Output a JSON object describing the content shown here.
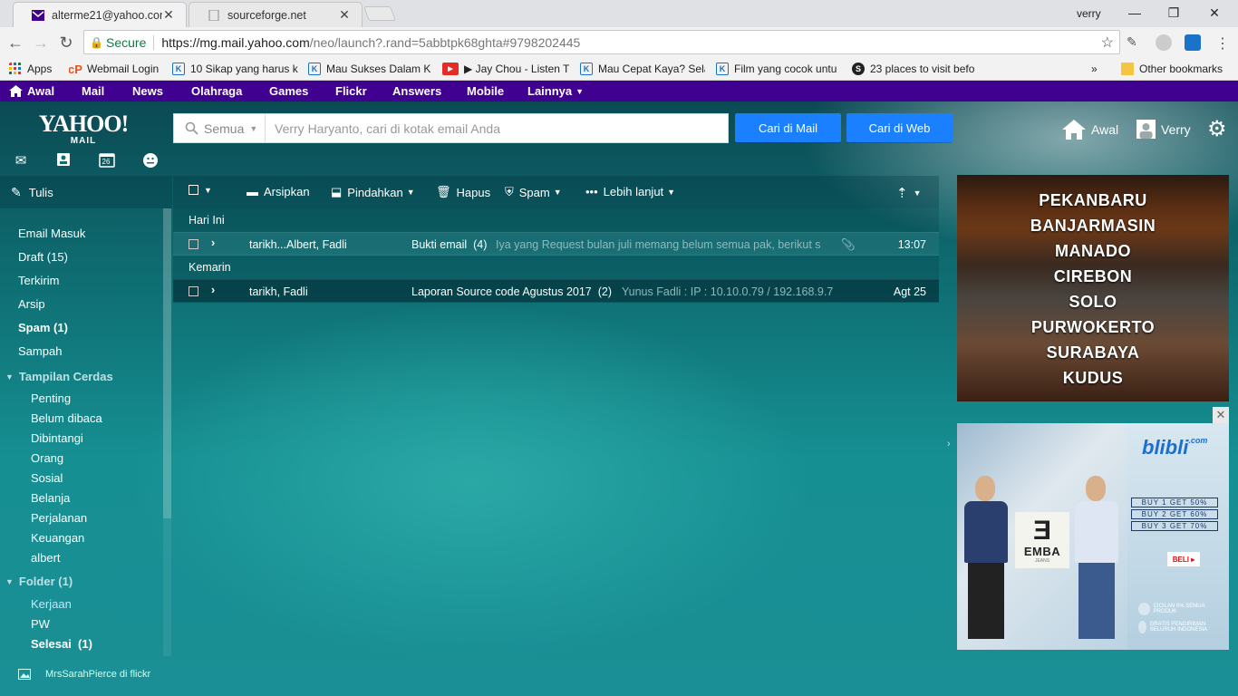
{
  "browser": {
    "tabs": [
      {
        "title": "alterme21@yahoo.com -",
        "favicon": "yahoo-mail-icon",
        "active": true
      },
      {
        "title": "sourceforge.net",
        "favicon": "page-icon",
        "active": false
      }
    ],
    "profile_name": "verry",
    "security_label": "Secure",
    "url_host": "https://mg.mail.yahoo.com",
    "url_path": "/neo/launch?.rand=5abbtpk68ghta#9798202445",
    "bookmarks": [
      {
        "label": "Apps",
        "icon": "apps-grid-icon"
      },
      {
        "label": "Webmail Login",
        "icon": "webmail-icon"
      },
      {
        "label": "10 Sikap yang harus k",
        "icon": "k-icon"
      },
      {
        "label": "Mau Sukses Dalam K",
        "icon": "k-icon"
      },
      {
        "label": "▶ Jay Chou - Listen T",
        "icon": "youtube-icon"
      },
      {
        "label": "Mau Cepat Kaya? Sela",
        "icon": "k-icon"
      },
      {
        "label": "Film yang cocok untu",
        "icon": "k-icon"
      },
      {
        "label": "23 places to visit befo",
        "icon": "scribd-icon"
      },
      {
        "label": "»",
        "icon": "more-icon"
      },
      {
        "label": "Other bookmarks",
        "icon": "folder-icon"
      }
    ]
  },
  "yahoo_nav": [
    "Awal",
    "Mail",
    "News",
    "Olahraga",
    "Games",
    "Flickr",
    "Answers",
    "Mobile",
    "Lainnya"
  ],
  "header": {
    "logo_top": "YAHOO!",
    "logo_bottom": "MAIL",
    "calendar_day": "26",
    "search_scope": "Semua",
    "search_placeholder": "Verry Haryanto, cari di kotak email Anda",
    "btn_mail": "Cari di Mail",
    "btn_web": "Cari di Web",
    "home_label": "Awal",
    "user_label": "Verry"
  },
  "sidebar": {
    "compose": "Tulis",
    "folders": [
      {
        "label": "Email Masuk",
        "bold": false
      },
      {
        "label": "Draft (15)",
        "bold": false
      },
      {
        "label": "Terkirim",
        "bold": false
      },
      {
        "label": "Arsip",
        "bold": false
      },
      {
        "label": "Spam (1)",
        "bold": true
      },
      {
        "label": "Sampah",
        "bold": false
      }
    ],
    "smart_title": "Tampilan Cerdas",
    "smart_views": [
      "Penting",
      "Belum dibaca",
      "Dibintangi",
      "Orang",
      "Sosial",
      "Belanja",
      "Perjalanan",
      "Keuangan",
      "albert"
    ],
    "folder_title": "Folder (1)",
    "user_folders": [
      "Kerjaan",
      "PW",
      "Selesai  (1)"
    ],
    "credit": "MrsSarahPierce di flickr"
  },
  "toolbar": {
    "archive": "Arsipkan",
    "move": "Pindahkan",
    "delete": "Hapus",
    "spam": "Spam",
    "more": "Lebih lanjut"
  },
  "messages": {
    "groups": [
      {
        "label": "Hari Ini",
        "rows": [
          {
            "from": "tarikh...Albert, Fadli",
            "subject": "Bukti email  (4)",
            "snippet": "Iya yang Request bulan juli memang belum semua pak, berikut s",
            "date": "13:07",
            "attachment": true
          }
        ]
      },
      {
        "label": "Kemarin",
        "rows": [
          {
            "from": "tarikh, Fadli",
            "subject": "Laporan Source code Agustus 2017  (2)",
            "snippet": "Yunus Fadli : IP : 10.10.0.79 / 192.168.9.7",
            "date": "Agt 25",
            "attachment": false
          }
        ]
      }
    ]
  },
  "ads": {
    "cities": [
      "PEKANBARU",
      "BANJARMASIN",
      "MANADO",
      "CIREBON",
      "SOLO",
      "PURWOKERTO",
      "SURABAYA",
      "KUDUS"
    ],
    "brand": "blibli",
    "brand_suffix": ".com",
    "logo_text": "EMBA",
    "logo_sub": "JEANS",
    "offers": [
      "BUY 1 GET 50%",
      "BUY 2 GET 60%",
      "BUY 3 GET 70%"
    ],
    "cta": "BELI ▸",
    "promo1": "CICILAN 0% SEMUA PRODUK",
    "promo2": "GRATIS PENGIRIMAN SELURUH INDONESIA"
  },
  "colors": {
    "yahoo_purple": "#400090",
    "button_blue": "#1a80ff",
    "secure_green": "#0b8043"
  }
}
